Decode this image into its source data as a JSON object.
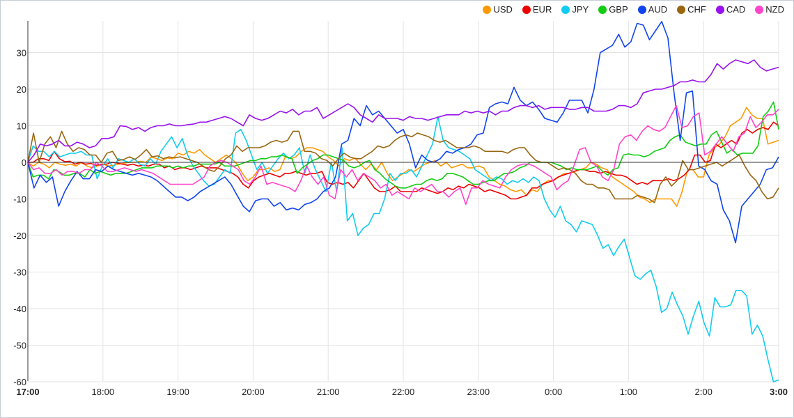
{
  "chart_data": {
    "type": "line",
    "title": "",
    "xlabel": "",
    "ylabel": "",
    "ylim": [
      -60,
      38
    ],
    "grid": true,
    "legend_position": "top-right",
    "x_ticks": [
      "17:00",
      "18:00",
      "19:00",
      "20:00",
      "21:00",
      "22:00",
      "23:00",
      "0:00",
      "1:00",
      "2:00",
      "3:00"
    ],
    "x_ticks_bold": [
      "17:00",
      "3:00"
    ],
    "y_ticks": [
      30,
      20,
      10,
      0,
      -10,
      -20,
      -30,
      -40,
      -50,
      -60
    ],
    "x_interval_minutes": 5,
    "x_start": "17:00",
    "x_end": "3:00",
    "series": [
      {
        "name": "USD",
        "color": "#ff9900",
        "values": [
          0,
          -1,
          0,
          -0.5,
          -1.5,
          0,
          -0.5,
          -0.8,
          -0.5,
          -1,
          0,
          -1,
          -1.5,
          -1,
          -0.5,
          -1,
          -0.8,
          -0.5,
          -0.2,
          0,
          0,
          0.3,
          0,
          1.5,
          1,
          0.5,
          1.2,
          1,
          2.5,
          2,
          3,
          2.5,
          3.5,
          2,
          1,
          0,
          1,
          2,
          1,
          -0.5,
          -3,
          -5,
          -4,
          -2,
          -2,
          -1.5,
          -2.5,
          -2,
          1.5,
          1,
          1.5,
          3,
          4,
          4,
          3.5,
          3,
          1.5,
          0.5,
          -1,
          1,
          0.5,
          1.2,
          -0.5,
          -2,
          -0.5,
          -2,
          0,
          -3,
          -5,
          -4,
          -3,
          -2,
          -2.5,
          -1.5,
          -0.5,
          0,
          0.5,
          -1,
          0,
          -1.5,
          -1,
          -0.5,
          -1.5,
          -1.5,
          -1,
          -1.5,
          -4,
          -5,
          -6,
          -6.5,
          -7.5,
          -8,
          -7.5,
          -9,
          -7.5,
          -8,
          -6,
          -5,
          -5,
          -4,
          -3,
          -3,
          -2.5,
          -2,
          -1.5,
          0,
          -0.5,
          -1.5,
          -2,
          -4,
          -5,
          -6,
          -7,
          -8,
          -9.5,
          -10,
          -11,
          -10,
          -10,
          -10,
          -10,
          -12,
          -8,
          -2,
          -2,
          -4,
          -4,
          2,
          4,
          5,
          7,
          10,
          11,
          12,
          15,
          13,
          12,
          12,
          5,
          5.5,
          6
        ]
      },
      {
        "name": "EUR",
        "color": "#ee0000",
        "values": [
          0,
          0,
          1,
          1,
          0.5,
          3,
          1,
          0.2,
          0.3,
          -0.5,
          0,
          -0.5,
          -0.3,
          -0.8,
          -0.5,
          -0.5,
          0,
          -0.2,
          -0.5,
          -0.8,
          -0.5,
          -1,
          -0.8,
          -1,
          -0.5,
          -0.5,
          -1.5,
          -1,
          -2,
          -1.5,
          -1.5,
          -2,
          -1.5,
          -1,
          -1.5,
          -1.5,
          -1.5,
          -2,
          -2.5,
          -3,
          -4,
          -6,
          -7,
          -5,
          -4,
          -3.5,
          -3,
          -3.5,
          -4,
          -3,
          -3,
          -2.5,
          -3,
          -3.5,
          -3,
          -3,
          -2.5,
          -5.5,
          -6,
          -5.5,
          -6,
          -5.5,
          -7,
          -5,
          -3,
          -5,
          -7,
          -8,
          -8,
          -7.5,
          -6.5,
          -8,
          -8,
          -8,
          -8,
          -7,
          -7.5,
          -8,
          -8.5,
          -8,
          -7,
          -7.5,
          -6.5,
          -7,
          -6,
          -6.5,
          -7,
          -8,
          -7.5,
          -8,
          -8.5,
          -9,
          -10,
          -10,
          -9.5,
          -9,
          -7,
          -7,
          -6,
          -5.5,
          -5,
          -4,
          -3.5,
          -3,
          -2.5,
          -2,
          -2,
          -2.5,
          -2.5,
          -3,
          -2.5,
          -3,
          -3.5,
          -3.5,
          -4,
          -5,
          -6,
          -5.5,
          -6,
          -5,
          -5,
          -5,
          -4.5,
          -5,
          -4.5,
          -3.5,
          -2,
          2,
          2,
          0,
          0.5,
          5,
          4,
          5,
          6,
          5,
          8,
          9,
          8,
          9,
          9.5,
          9,
          11,
          10
        ]
      },
      {
        "name": "JPY",
        "color": "#11ccf0",
        "values": [
          0,
          4.5,
          3,
          3,
          1.5,
          3,
          1.5,
          2,
          2.5,
          2.5,
          3,
          2,
          2,
          -4.5,
          -1,
          1,
          -1.5,
          1,
          0.5,
          0,
          1,
          -0.5,
          -1,
          1,
          -0.5,
          3,
          5,
          7,
          4,
          6.5,
          2,
          -1,
          -3,
          -5,
          -6.5,
          -6,
          -4,
          -2,
          -3,
          8,
          9,
          6,
          2,
          -2,
          0,
          -3,
          -1,
          1,
          2.5,
          1,
          2,
          4,
          -3,
          2,
          -2,
          -5,
          -8,
          0,
          -8,
          4,
          -16,
          -14,
          -20,
          -18,
          -17,
          -14,
          -14,
          -10,
          -3,
          -5,
          -3,
          -3,
          -2,
          -4,
          -1,
          2,
          5,
          12.5,
          6,
          4,
          3.5,
          3,
          2,
          1,
          -2,
          -3,
          -4,
          -5,
          -4,
          -4.5,
          -6,
          -5,
          -5.5,
          -4.5,
          -5.5,
          -4,
          -5,
          -10,
          -13,
          -15,
          -12,
          -16,
          -17,
          -19,
          -16,
          -16.5,
          -17,
          -20,
          -23.5,
          -22.5,
          -25.5,
          -23,
          -21,
          -26,
          -31,
          -32,
          -30.5,
          -29.5,
          -34,
          -41,
          -40,
          -35.5,
          -39,
          -42,
          -47,
          -42,
          -38,
          -44,
          -47.5,
          -37,
          -39.5,
          -39.5,
          -39,
          -35,
          -35,
          -36.5,
          -47,
          -44.5,
          -47.5,
          -54,
          -60,
          -59.5
        ]
      },
      {
        "name": "GBP",
        "color": "#11cc11",
        "values": [
          0,
          -4,
          -3.5,
          -3.5,
          -4.5,
          -2,
          -2.5,
          -3.5,
          -3.5,
          -3,
          -3,
          -4,
          -2,
          -3,
          -2.5,
          -3,
          -3.5,
          -3,
          -3,
          -3,
          -2.5,
          -2,
          -1.5,
          -1.5,
          -1.5,
          -1,
          -1,
          -1,
          -1.5,
          -1,
          -1.5,
          -1,
          -1,
          -0.5,
          -0.5,
          -0.5,
          -0.5,
          0,
          -1,
          -1,
          -1,
          -0.5,
          0,
          0.5,
          0.5,
          1,
          1,
          1.5,
          1.5,
          2,
          1.5,
          1,
          -3,
          -1.5,
          -0.5,
          0.5,
          1,
          2,
          2,
          1.5,
          1,
          0.5,
          -1,
          -1.5,
          -1,
          0,
          0.5,
          -2,
          -3,
          -4.5,
          -5.5,
          -6.5,
          -7,
          -7,
          -6.5,
          -6,
          -6,
          -5,
          -4.5,
          -5,
          -4.5,
          -3,
          -3,
          -3.5,
          -4,
          -5,
          -6,
          -6,
          -5.5,
          -5,
          -5,
          -4,
          -3,
          -3,
          -2.5,
          -1.5,
          -1,
          0,
          0,
          0,
          0,
          0,
          -0.5,
          -1,
          -2,
          -1.5,
          -2,
          -2,
          -2,
          -1.5,
          -1,
          -2.5,
          -3.5,
          -2,
          -1.5,
          2,
          2.3,
          2,
          2,
          1.5,
          2,
          3,
          3.5,
          4,
          6,
          7,
          7.5,
          5.5,
          5,
          4.5,
          5,
          5,
          7.5,
          8.5,
          5.5,
          2.5,
          3.5,
          2,
          2.5,
          2.5,
          2.5,
          4.5,
          12.5,
          14,
          16.5,
          9
        ]
      },
      {
        "name": "AUD",
        "color": "#1144ee",
        "values": [
          0,
          -7,
          -3.5,
          -5.5,
          -4,
          -12,
          -8,
          -5,
          -2.5,
          -4.5,
          -4.5,
          -2,
          -2.5,
          -1,
          -2,
          -2.5,
          -3,
          -3.5,
          -3,
          -3.5,
          -4,
          -5,
          -6.5,
          -8,
          -9.5,
          -9.5,
          -10.5,
          -9.5,
          -8,
          -7,
          -6,
          -5,
          -4,
          -6,
          -9,
          -12,
          -13.5,
          -10.5,
          -10,
          -10,
          -12,
          -11,
          -13,
          -12.5,
          -13,
          -11.5,
          -11,
          -10,
          -8,
          -7,
          -4,
          5,
          6,
          12,
          10,
          15.5,
          13,
          14,
          12,
          10,
          8,
          9,
          5,
          -1.5,
          2,
          0.5,
          0,
          1,
          3,
          2.5,
          3.5,
          4,
          5,
          7.5,
          8,
          15,
          16,
          16.5,
          16,
          20.5,
          17,
          15.5,
          16.5,
          14.5,
          12,
          11.5,
          11,
          13.5,
          17,
          17,
          17,
          13.5,
          20,
          30,
          31,
          32,
          35,
          31.5,
          33,
          38,
          37.5,
          33.5,
          36,
          38.5,
          34,
          19,
          6,
          19,
          19.5,
          -1,
          -2,
          -5,
          -6,
          -13,
          -16,
          -22,
          -12,
          -10,
          -8,
          -6,
          -2,
          -1.5,
          1.5
        ]
      },
      {
        "name": "CHF",
        "color": "#996611",
        "values": [
          0,
          8,
          0,
          5,
          7,
          4,
          8.5,
          5,
          3,
          4,
          3.5,
          2,
          2,
          0,
          2.5,
          3,
          0.5,
          0.8,
          1.5,
          0.8,
          2,
          3.5,
          1.5,
          1.8,
          1,
          1.5,
          1.2,
          1.5,
          1,
          0.5,
          0,
          -1,
          -2,
          -2.5,
          -1,
          1,
          2,
          4.5,
          3,
          4,
          4,
          4,
          4.5,
          5.5,
          6,
          5.5,
          6,
          8.5,
          8.5,
          3,
          3,
          2.5,
          1,
          0.5,
          -1,
          1,
          2.5,
          1.5,
          1,
          1,
          2,
          3,
          4.5,
          4,
          4.5,
          6,
          7,
          7.5,
          7,
          8,
          7.5,
          7,
          6,
          5.5,
          6,
          5,
          4,
          4,
          4,
          4.5,
          4,
          3,
          3,
          3,
          3,
          2.5,
          3.5,
          4,
          4,
          2,
          0.5,
          0,
          0,
          -1,
          -2,
          -1.5,
          -2,
          -3,
          -5,
          -6,
          -6,
          -7,
          -7,
          -7.5,
          -10,
          -10,
          -10,
          -10,
          -9,
          -9.5,
          -10,
          -11,
          -6,
          -4,
          -6.5,
          -5,
          0.5,
          -2,
          -2,
          -1.5,
          -1,
          -0.5,
          0,
          -1,
          0,
          1,
          2,
          -1,
          -3.5,
          -5,
          -8,
          -10,
          -9.5,
          -7
        ]
      },
      {
        "name": "CAD",
        "color": "#9911ee",
        "values": [
          0,
          2,
          5,
          4.5,
          5,
          6,
          4.5,
          4.5,
          5.5,
          5,
          4,
          4.5,
          6.5,
          6.5,
          7,
          10,
          9.8,
          9,
          9.5,
          8.5,
          9.5,
          10,
          10,
          10.5,
          10,
          10,
          10.3,
          10.5,
          11,
          11,
          11.5,
          12,
          12.5,
          12,
          11,
          10,
          13,
          12,
          11.5,
          12,
          13,
          14,
          13.5,
          14.5,
          13,
          14,
          14,
          15,
          12,
          13,
          14,
          15,
          16,
          15,
          13,
          12,
          11,
          13,
          12,
          12,
          12,
          11.5,
          12.5,
          12,
          12,
          11.5,
          12,
          12.5,
          13,
          13,
          13,
          14,
          13.5,
          14,
          13.5,
          14,
          13,
          14,
          14,
          15,
          15.5,
          15.5,
          15,
          15.5,
          14.5,
          15,
          15,
          15,
          14.5,
          14.5,
          15,
          15,
          14,
          14,
          14,
          14.5,
          15.5,
          15.5,
          15,
          16,
          19,
          19.5,
          20,
          20,
          20.5,
          21,
          22,
          22,
          22.5,
          22,
          22,
          24,
          27,
          25.5,
          27,
          28,
          27.5,
          27,
          28,
          26,
          25,
          25.5,
          26
        ]
      },
      {
        "name": "NZD",
        "color": "#ff44cc",
        "values": [
          0,
          -2,
          -1.5,
          -3,
          -3,
          -2,
          -3.5,
          -2.5,
          -2.5,
          -3,
          -2,
          -2,
          0,
          -1,
          -2.5,
          -2.5,
          -2,
          -1.5,
          -2,
          -2.5,
          -2,
          -2.5,
          -3,
          -4,
          -5,
          -6,
          -6,
          -6,
          -6,
          -6,
          -5,
          -4,
          -1,
          0,
          0.5,
          0,
          -1,
          -2,
          -5,
          -6,
          -4,
          -1,
          -6,
          -5.5,
          -6,
          -6.5,
          -7,
          -8,
          -5,
          -1,
          -4,
          -6,
          -4,
          -9,
          -10,
          -2,
          -4,
          -2,
          -5,
          -3,
          -4,
          -5,
          -7,
          -6,
          -9,
          -8,
          -9,
          -10,
          -7,
          -8,
          -7,
          -6,
          -8,
          -8,
          -9.5,
          -8,
          -7,
          -11.5,
          -7,
          -7,
          -5,
          -6,
          -6.5,
          -7,
          -4,
          -2,
          -1,
          -0.5,
          -0.5,
          -1,
          -2,
          -3,
          -4,
          -7.5,
          -6,
          -5,
          -1,
          3.5,
          4,
          0,
          -1,
          -4,
          -5,
          -2,
          5,
          7,
          7.5,
          6,
          8.5,
          10,
          9,
          8.5,
          9.5,
          12.5,
          15.5,
          9.5,
          10,
          12.5,
          13.5,
          2,
          3,
          5,
          7,
          5,
          3,
          7,
          8,
          12.5,
          9.5,
          11,
          13,
          13,
          14.5
        ]
      }
    ]
  }
}
